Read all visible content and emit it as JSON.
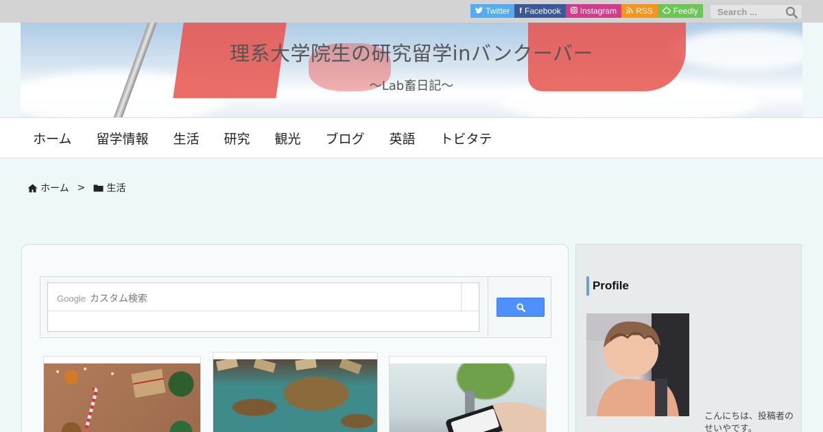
{
  "topbar": {
    "social": [
      {
        "label": "Twitter",
        "icon": "twitter-icon",
        "glyph": "🐦",
        "color": "#55acee"
      },
      {
        "label": "Facebook",
        "icon": "facebook-icon",
        "glyph": "f",
        "color": "#3b5998"
      },
      {
        "label": "Instagram",
        "icon": "instagram-icon",
        "glyph": "◎",
        "color": "#d23d8b"
      },
      {
        "label": "RSS",
        "icon": "rss-icon",
        "glyph": "◔",
        "color": "#f7941e"
      },
      {
        "label": "Feedly",
        "icon": "feedly-icon",
        "glyph": "◈",
        "color": "#6cc655"
      }
    ],
    "search_placeholder": "Search ..."
  },
  "header": {
    "title": "理系大学院生の研究留学inバンクーバー",
    "subtitle": "～Lab畜日記～"
  },
  "nav": {
    "items": [
      "ホーム",
      "留学情報",
      "生活",
      "研究",
      "観光",
      "ブログ",
      "英語",
      "トビタテ"
    ]
  },
  "breadcrumb": {
    "home": "ホーム",
    "separator": ">",
    "current": "生活"
  },
  "custom_search": {
    "brand": "Google",
    "placeholder": "カスタム検索"
  },
  "sidebar": {
    "heading": "Profile",
    "text": "こんにちは、投稿者のせいやです。"
  },
  "colors": {
    "twitter": "#55acee",
    "facebook": "#3b5998",
    "instagram": "#d23d8b",
    "rss": "#f7941e",
    "feedly": "#6cc655",
    "search_button": "#4d90fe",
    "accent_bar": "#6ba0d8"
  }
}
